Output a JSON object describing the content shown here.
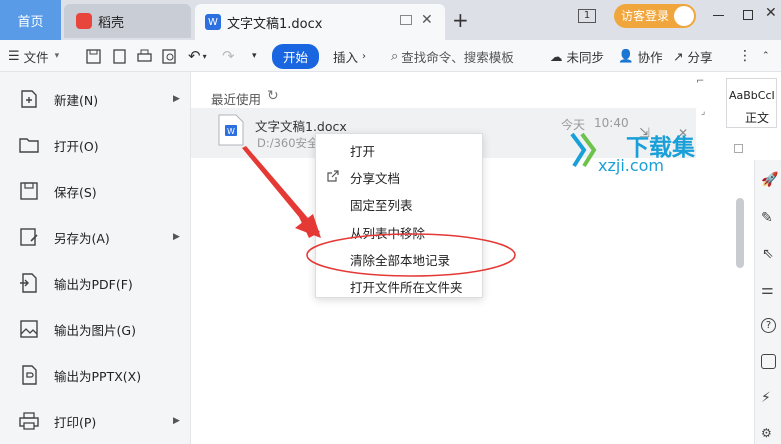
{
  "tabs": {
    "home": "首页",
    "daoke": "稻壳",
    "doc": "文字文稿1.docx",
    "new_tab": "+"
  },
  "window": {
    "badge": "1",
    "login": "访客登录"
  },
  "toolbar": {
    "file": "文件",
    "start": "开始",
    "insert": "插入",
    "search": "查找命令、搜索模板",
    "sync": "未同步",
    "collab": "协作",
    "share": "分享"
  },
  "file_menu": [
    {
      "label": "新建(N)",
      "icon": "new-document-icon",
      "submenu": true
    },
    {
      "label": "打开(O)",
      "icon": "folder-open-icon",
      "submenu": false
    },
    {
      "label": "保存(S)",
      "icon": "save-icon",
      "submenu": false
    },
    {
      "label": "另存为(A)",
      "icon": "save-as-icon",
      "submenu": true
    },
    {
      "label": "输出为PDF(F)",
      "icon": "export-pdf-icon",
      "submenu": false
    },
    {
      "label": "输出为图片(G)",
      "icon": "export-image-icon",
      "submenu": false
    },
    {
      "label": "输出为PPTX(X)",
      "icon": "export-pptx-icon",
      "submenu": false
    },
    {
      "label": "打印(P)",
      "icon": "print-icon",
      "submenu": true
    }
  ],
  "recent": {
    "heading": "最近使用",
    "file": {
      "name": "文字文稿1.docx",
      "path": "D:/360安全",
      "date": "今天",
      "time": "10:40"
    }
  },
  "context_menu": [
    "打开",
    "分享文档",
    "固定至列表",
    "从列表中移除",
    "清除全部本地记录",
    "打开文件所在文件夹"
  ],
  "styles": {
    "sample": "AaBbCcI",
    "name": "正文"
  },
  "watermark": {
    "brand": "下载集",
    "domain": "xzji.com"
  },
  "colors": {
    "accent": "#1a66e0",
    "tab_home": "#5a9be8",
    "login": "#f0a63c",
    "annotation": "#e53935"
  }
}
